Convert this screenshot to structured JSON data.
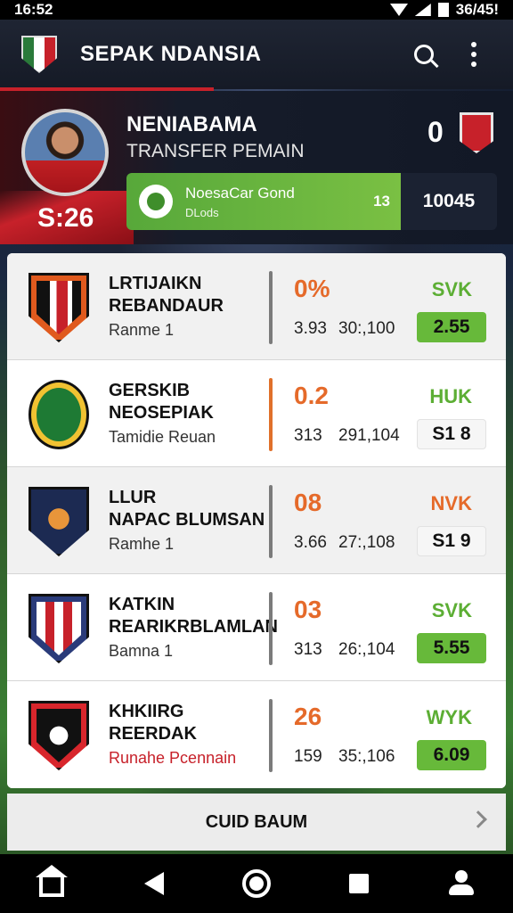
{
  "status_bar": {
    "time": "16:52",
    "right_text": "36/45!"
  },
  "app_bar": {
    "title": "SEPAK NDANSIA",
    "search_icon": "search-icon",
    "menu_icon": "more-vert-icon"
  },
  "hero": {
    "name": "NENIABAMA",
    "subtitle": "TRANSFER PEMAIN",
    "score": "S:26",
    "count": "0",
    "promo": {
      "title": "NoesaCar Gond",
      "sub": "DLods",
      "number": "13",
      "value": "10045"
    }
  },
  "teams": [
    {
      "name1": "LRTIJAIKN",
      "name2": "REBANDAUR",
      "sub": "Ranme 1",
      "pct": "0%",
      "stat_a": "3.93",
      "stat_b": "30:,100",
      "code": "SVK",
      "price": "2.55",
      "code_color": "green",
      "price_style": "green"
    },
    {
      "name1": "GERSKIB",
      "name2": "NEOSEPIAK",
      "sub": "Tamidie Reuan",
      "pct": "0.2",
      "stat_a": "313",
      "stat_b": "291,104",
      "code": "HUK",
      "price": "S1 8",
      "code_color": "green",
      "price_style": "light"
    },
    {
      "name1": "LLUR",
      "name2": "NAPAC BLUMSAN",
      "sub": "Ramhe 1",
      "pct": "08",
      "stat_a": "3.66",
      "stat_b": "27:,108",
      "code": "NVK",
      "price": "S1 9",
      "code_color": "orange",
      "price_style": "light"
    },
    {
      "name1": "KATKIN",
      "name2": "REARIKRBLAMLAN",
      "sub": "Bamna 1",
      "pct": "03",
      "stat_a": "313",
      "stat_b": "26:,104",
      "code": "SVK",
      "price": "5.55",
      "code_color": "green",
      "price_style": "green"
    },
    {
      "name1": "KHKIIRG",
      "name2": "REERDAK",
      "sub": "Runahe Pcennain",
      "pct": "26",
      "stat_a": "159",
      "stat_b": "35:,106",
      "code": "WYK",
      "price": "6.09",
      "code_color": "green",
      "price_style": "green"
    }
  ],
  "footer": {
    "label": "CUID BAUM"
  },
  "nav": [
    "home-icon",
    "back-icon",
    "home-circle-icon",
    "recents-icon",
    "profile-icon"
  ]
}
